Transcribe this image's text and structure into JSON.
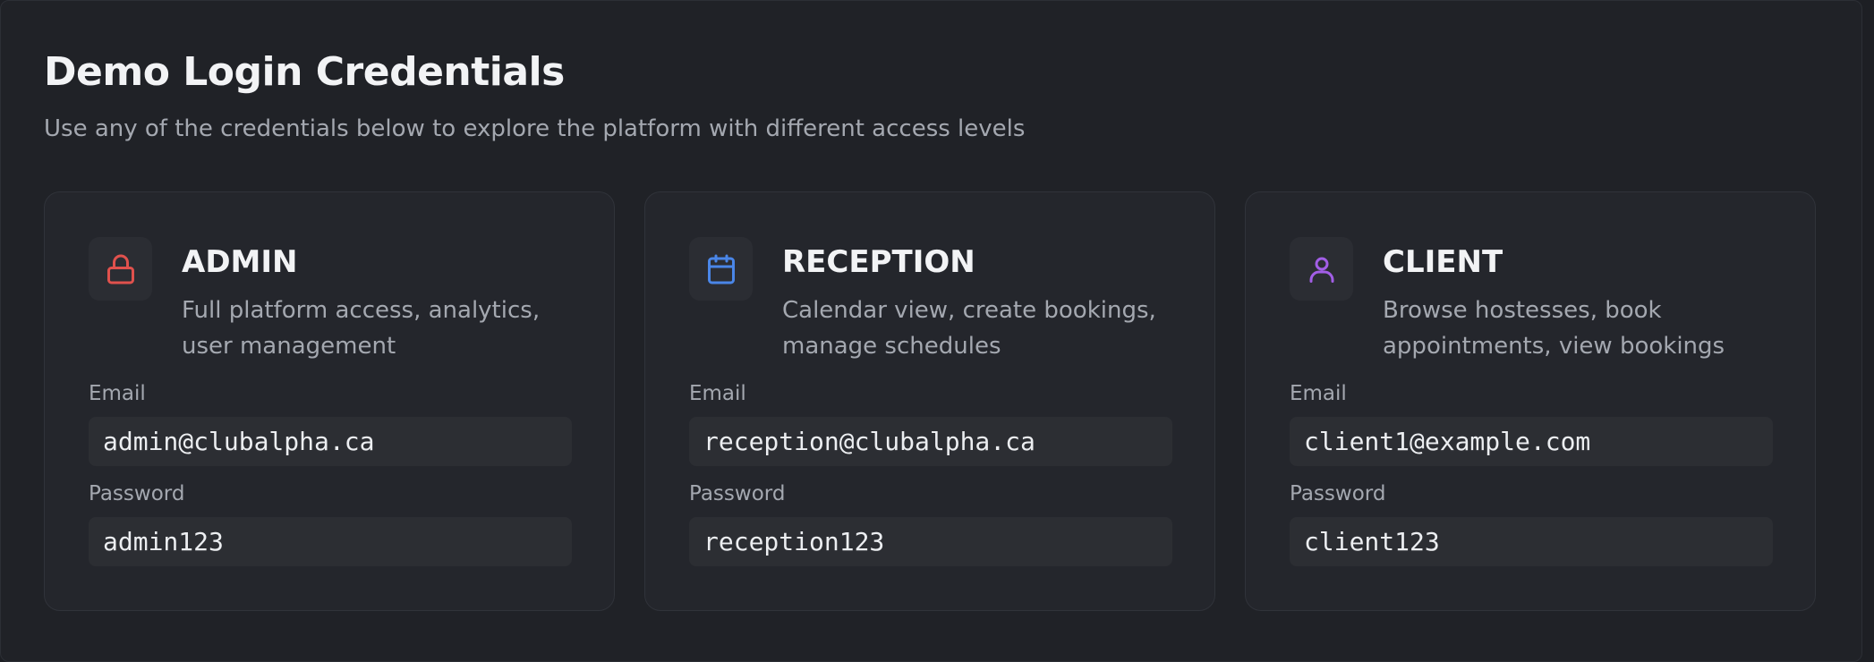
{
  "header": {
    "title": "Demo Login Credentials",
    "subtitle": "Use any of the credentials below to explore the platform with different access levels"
  },
  "labels": {
    "email": "Email",
    "password": "Password"
  },
  "cards": [
    {
      "role": "ADMIN",
      "description": "Full platform access, analytics, user management",
      "icon": "lock-icon",
      "icon_color": "#e0514d",
      "email": "admin@clubalpha.ca",
      "password": "admin123"
    },
    {
      "role": "RECEPTION",
      "description": "Calendar view, create bookings, manage schedules",
      "icon": "calendar-icon",
      "icon_color": "#4a86e8",
      "email": "reception@clubalpha.ca",
      "password": "reception123"
    },
    {
      "role": "CLIENT",
      "description": "Browse hostesses, book appointments, view bookings",
      "icon": "user-icon",
      "icon_color": "#a25ee6",
      "email": "client1@example.com",
      "password": "client123"
    }
  ]
}
